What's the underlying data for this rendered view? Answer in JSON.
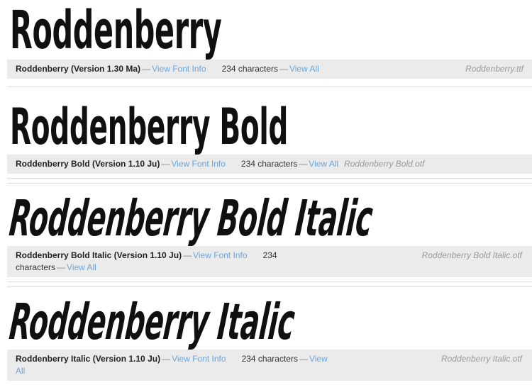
{
  "page": {
    "title": "Font List",
    "link_color": "#6ca6d9",
    "bar_color": "#ebebeb",
    "divider_color": "#dddddd",
    "text_color": "#333333",
    "filename_color": "#9a9a9a"
  },
  "labels": {
    "view_font_info": "View Font Info",
    "view_all": "View All",
    "view": "View",
    "all": "All",
    "characters": "characters",
    "dash": "—"
  },
  "fonts": [
    {
      "specimen": "Roddenberry",
      "name_version": "Roddenberry (Version 1.30 Ma)",
      "char_count": "234",
      "char_label": "234 characters",
      "filename": "Roddenberry.ttf",
      "style": "regular",
      "wrap": "none"
    },
    {
      "specimen": "Roddenberry Bold",
      "name_version": "Roddenberry Bold (Version 1.10 Ju)",
      "char_count": "234",
      "char_label": "234 characters",
      "filename": "Roddenberry Bold.otf",
      "style": "bold",
      "wrap": "none"
    },
    {
      "specimen": "Roddenberry Bold Italic",
      "name_version": "Roddenberry Bold Italic (Version 1.10 Ju)",
      "char_count": "234",
      "char_label": "characters",
      "filename": "Roddenberry Bold Italic.otf",
      "style": "bold-italic",
      "wrap": "after-count"
    },
    {
      "specimen": "Roddenberry Italic",
      "name_version": "Roddenberry Italic (Version 1.10 Ju)",
      "char_count": "234",
      "char_label": "234 characters",
      "filename": "Roddenberry Italic.otf",
      "style": "italic",
      "wrap": "after-view"
    }
  ]
}
